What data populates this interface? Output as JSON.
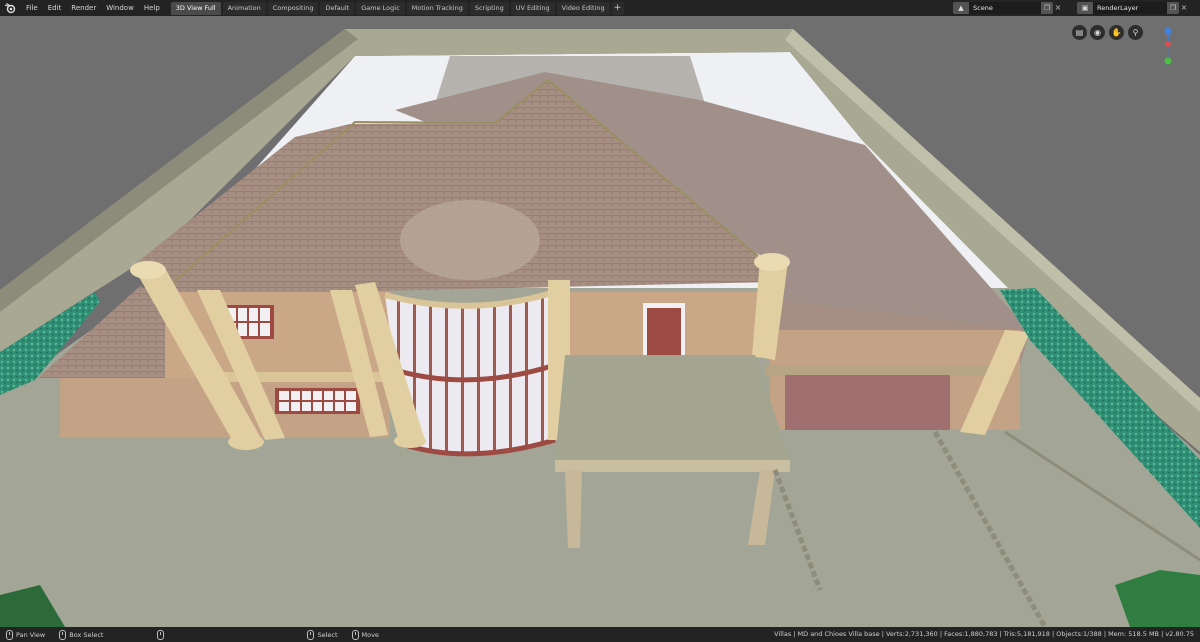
{
  "menu": [
    "File",
    "Edit",
    "Render",
    "Window",
    "Help"
  ],
  "workspaces": [
    "3D View Full",
    "Animation",
    "Compositing",
    "Default",
    "Game Logic",
    "Motion Tracking",
    "Scripting",
    "UV Editing",
    "Video Editing"
  ],
  "active_workspace": "3D View Full",
  "add_workspace_label": "+",
  "scene_field": {
    "value": "Scene"
  },
  "render_layer_field": {
    "value": "RenderLayer"
  },
  "status": {
    "pan_label": "Pan View",
    "box_select_label": "Box Select",
    "select_label": "Select",
    "move_label": "Move",
    "stats": "Villas | MD and Chioes Villa base | Verts:2,731,360 | Faces:1,880,783 | Tris:5,181,918 | Objects:1/388 | Mem: 518.5 MB | v2.80.75"
  },
  "colors": {
    "header_bg": "#232323",
    "viewport_bg": "#6f6f6f",
    "ground": "#a3a696",
    "roof": "#a68f82",
    "wall": "#c8a686",
    "column": "#e2cfa1",
    "hedge": "#2d8f74",
    "axis_x": "#e04a4a",
    "axis_y": "#4ac04a",
    "axis_z": "#3f82e0"
  }
}
